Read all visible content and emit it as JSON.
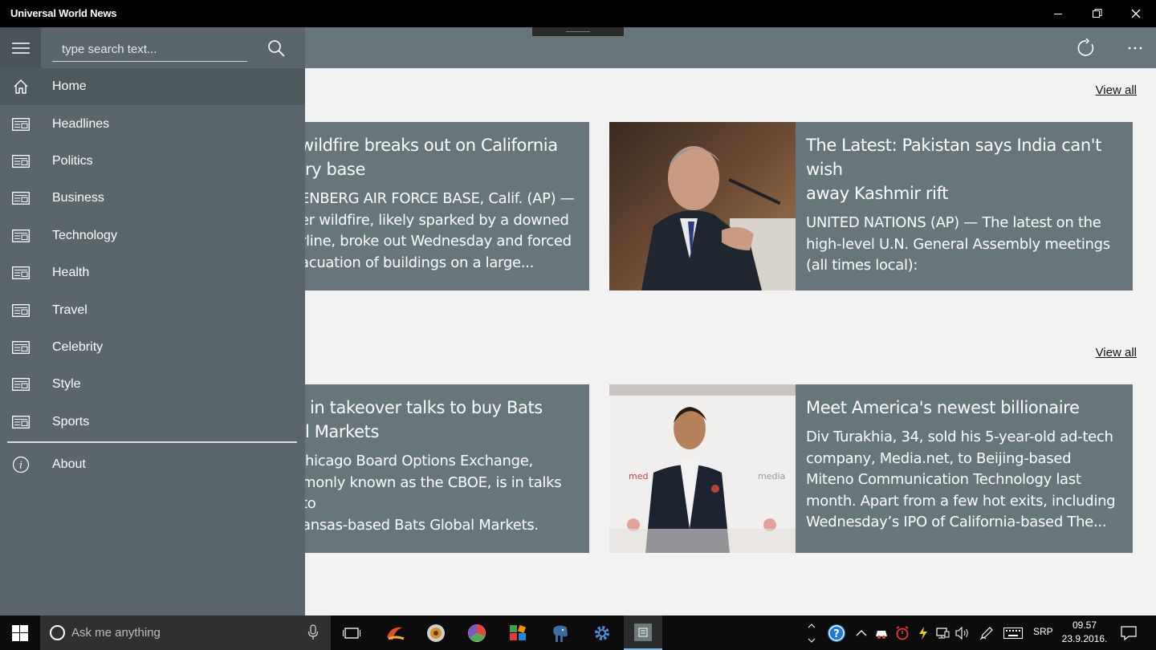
{
  "window": {
    "title": "Universal World News"
  },
  "header": {
    "refresh_icon": "refresh-icon",
    "more_icon": "more-icon"
  },
  "search": {
    "placeholder": "type search text..."
  },
  "nav": {
    "items": [
      {
        "label": "Home",
        "icon": "home-icon"
      },
      {
        "label": "Headlines",
        "icon": "news-icon"
      },
      {
        "label": "Politics",
        "icon": "news-icon"
      },
      {
        "label": "Business",
        "icon": "news-icon"
      },
      {
        "label": "Technology",
        "icon": "news-icon"
      },
      {
        "label": "Health",
        "icon": "news-icon"
      },
      {
        "label": "Travel",
        "icon": "news-icon"
      },
      {
        "label": "Celebrity",
        "icon": "news-icon"
      },
      {
        "label": "Style",
        "icon": "news-icon"
      },
      {
        "label": "Sports",
        "icon": "news-icon"
      }
    ],
    "about": {
      "label": "About",
      "icon": "info-icon"
    }
  },
  "sections": [
    {
      "view_all": "View all",
      "cards": [
        {
          "title": "wildfire breaks out on California ry base",
          "title_lines": [
            "wildfire breaks out on California",
            "ry base"
          ],
          "body_lines": [
            "ENBERG AIR FORCE BASE, Calif. (AP) —",
            "er wildfire, likely sparked by a downed",
            "rline, broke out Wednesday and forced",
            "acuation of buildings on a large..."
          ]
        },
        {
          "title_lines": [
            "The Latest: Pakistan says India can't wish",
            "away Kashmir rift"
          ],
          "body_lines": [
            "UNITED NATIONS (AP) — The latest on the",
            "high-level U.N. General Assembly meetings",
            "(all times local):"
          ]
        }
      ]
    },
    {
      "view_all": "View all",
      "cards": [
        {
          "title_lines": [
            "in takeover talks to buy Bats",
            "l Markets"
          ],
          "body_lines": [
            "hicago Board Options Exchange,",
            "monly known as the CBOE, is in talks to",
            "ansas-based Bats Global Markets."
          ]
        },
        {
          "title_lines": [
            "Meet America's newest billionaire"
          ],
          "body_lines": [
            "Div Turakhia, 34, sold his 5-year-old ad-tech",
            "company, Media.net, to Beijing-based",
            "Miteno Communication Technology last",
            "month. Apart from a few hot exits, including",
            "Wednesday’s IPO of California-based The..."
          ]
        }
      ]
    }
  ],
  "taskbar": {
    "cortana_placeholder": "Ask me anything",
    "language": "SRP",
    "time": "09.57",
    "date": "23.9.2016."
  }
}
